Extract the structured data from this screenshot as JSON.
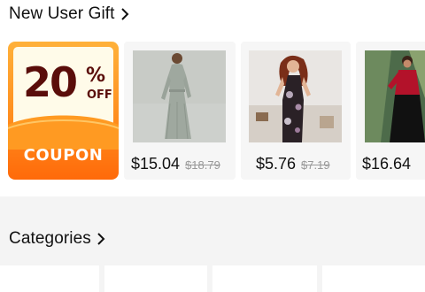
{
  "new_user_gift": {
    "title": "New User Gift",
    "coupon": {
      "percent": "20",
      "percent_sign": "%",
      "off": "OFF",
      "label": "COUPON"
    },
    "products": [
      {
        "price": "$15.04",
        "original_price": "$18.79",
        "image": "woman-in-grey-long-dress"
      },
      {
        "price": "$5.76",
        "original_price": "$7.19",
        "image": "woman-in-floral-slip-dress"
      },
      {
        "price": "$16.64",
        "original_price": "",
        "image": "woman-in-red-black-dress"
      }
    ]
  },
  "categories": {
    "title": "Categories"
  },
  "colors": {
    "coupon_orange": "#ff8a1c",
    "coupon_text": "#5a0d0a",
    "page_bg": "#f4f4f4"
  },
  "icons": {
    "section_more": "chevron-right-icon"
  }
}
